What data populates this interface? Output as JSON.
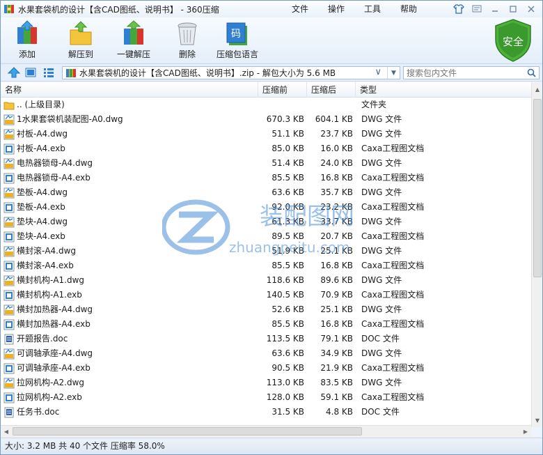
{
  "window": {
    "title": "水果套袋机的设计【含CAD图纸、说明书】 - 360压缩",
    "menu": [
      "文件",
      "操作",
      "工具",
      "帮助"
    ]
  },
  "toolbar": {
    "buttons": [
      {
        "label": "添加",
        "icon": "add-archive-icon"
      },
      {
        "label": "解压到",
        "icon": "extract-to-icon"
      },
      {
        "label": "一键解压",
        "icon": "one-click-extract-icon"
      },
      {
        "label": "删除",
        "icon": "trash-can-icon"
      },
      {
        "label": "压缩包语言",
        "icon": "archive-language-icon"
      }
    ],
    "badge_label": "安全",
    "language_glyph": "码"
  },
  "addressbar": {
    "path": "水果套袋机的设计【含CAD图纸、说明书】.zip - 解包大小为 5.6 MB",
    "search_placeholder": "搜索包内文件"
  },
  "columns": [
    "名称",
    "压缩前",
    "压缩后",
    "类型"
  ],
  "files": [
    {
      "name": ".. (上级目录)",
      "size": "",
      "packed": "",
      "type": "文件夹",
      "kind": "folder"
    },
    {
      "name": "1水果套袋机装配图-A0.dwg",
      "size": "670.3 KB",
      "packed": "604.1 KB",
      "type": "DWG 文件",
      "kind": "dwg"
    },
    {
      "name": "衬板-A4.dwg",
      "size": "51.1 KB",
      "packed": "23.7 KB",
      "type": "DWG 文件",
      "kind": "dwg"
    },
    {
      "name": "衬板-A4.exb",
      "size": "85.0 KB",
      "packed": "16.0 KB",
      "type": "Caxa工程图文档",
      "kind": "exb"
    },
    {
      "name": "电热器锁母-A4.dwg",
      "size": "51.4 KB",
      "packed": "24.0 KB",
      "type": "DWG 文件",
      "kind": "dwg"
    },
    {
      "name": "电热器锁母-A4.exb",
      "size": "85.5 KB",
      "packed": "16.8 KB",
      "type": "Caxa工程图文档",
      "kind": "exb"
    },
    {
      "name": "垫板-A4.dwg",
      "size": "63.6 KB",
      "packed": "35.7 KB",
      "type": "DWG 文件",
      "kind": "dwg"
    },
    {
      "name": "垫板-A4.exb",
      "size": "92.0 KB",
      "packed": "23.2 KB",
      "type": "Caxa工程图文档",
      "kind": "exb"
    },
    {
      "name": "垫块-A4.dwg",
      "size": "61.3 KB",
      "packed": "33.7 KB",
      "type": "DWG 文件",
      "kind": "dwg"
    },
    {
      "name": "垫块-A4.exb",
      "size": "89.5 KB",
      "packed": "20.7 KB",
      "type": "Caxa工程图文档",
      "kind": "exb"
    },
    {
      "name": "横封滚-A4.dwg",
      "size": "51.9 KB",
      "packed": "25.1 KB",
      "type": "DWG 文件",
      "kind": "dwg"
    },
    {
      "name": "横封滚-A4.exb",
      "size": "85.5 KB",
      "packed": "16.8 KB",
      "type": "Caxa工程图文档",
      "kind": "exb"
    },
    {
      "name": "横封机构-A1.dwg",
      "size": "118.6 KB",
      "packed": "89.6 KB",
      "type": "DWG 文件",
      "kind": "dwg"
    },
    {
      "name": "横封机构-A1.exb",
      "size": "140.5 KB",
      "packed": "70.9 KB",
      "type": "Caxa工程图文档",
      "kind": "exb"
    },
    {
      "name": "横封加热器-A4.dwg",
      "size": "52.6 KB",
      "packed": "25.1 KB",
      "type": "DWG 文件",
      "kind": "dwg"
    },
    {
      "name": "横封加热器-A4.exb",
      "size": "85.5 KB",
      "packed": "16.8 KB",
      "type": "Caxa工程图文档",
      "kind": "exb"
    },
    {
      "name": "开题报告.doc",
      "size": "113.5 KB",
      "packed": "79.1 KB",
      "type": "DOC 文件",
      "kind": "doc"
    },
    {
      "name": "可调轴承座-A4.dwg",
      "size": "63.6 KB",
      "packed": "34.9 KB",
      "type": "DWG 文件",
      "kind": "dwg"
    },
    {
      "name": "可调轴承座-A4.exb",
      "size": "90.5 KB",
      "packed": "21.9 KB",
      "type": "Caxa工程图文档",
      "kind": "exb"
    },
    {
      "name": "拉网机构-A2.dwg",
      "size": "113.0 KB",
      "packed": "83.5 KB",
      "type": "DWG 文件",
      "kind": "dwg"
    },
    {
      "name": "拉网机构-A2.exb",
      "size": "128.0 KB",
      "packed": "59.1 KB",
      "type": "Caxa工程图文档",
      "kind": "exb"
    },
    {
      "name": "任务书.doc",
      "size": "31.5 KB",
      "packed": "4.8 KB",
      "type": "DOC 文件",
      "kind": "doc"
    }
  ],
  "status": "大小: 3.2 MB 共 40 个文件 压缩率 58.0%",
  "watermark": {
    "cn": "装配图网",
    "en": "zhuangpeitu.com"
  },
  "colors": {
    "accent": "#2f7fd3",
    "shield": "#3a9a2e",
    "watermark": "#4a8fd6"
  }
}
